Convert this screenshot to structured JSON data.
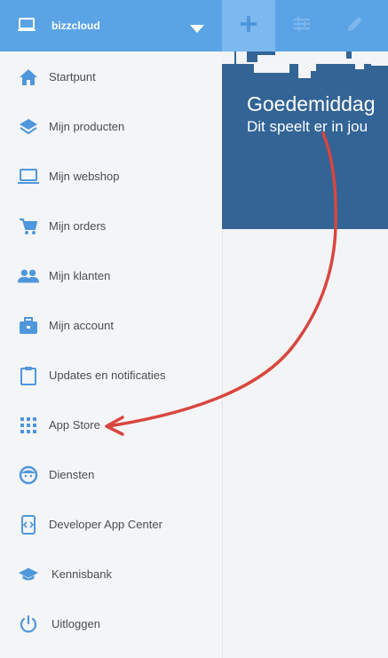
{
  "brand": {
    "name": "bizzcloud"
  },
  "toolbar": {
    "add_icon": "plus-icon",
    "filter_icon": "sliders-icon",
    "edit_icon": "pencil-icon"
  },
  "banner": {
    "greeting": "Goedemiddag",
    "subtitle": "Dit speelt er in jou"
  },
  "menu": [
    {
      "label": "Startpunt",
      "icon": "home-icon"
    },
    {
      "label": "Mijn producten",
      "icon": "layers-icon"
    },
    {
      "label": "Mijn webshop",
      "icon": "laptop-icon"
    },
    {
      "label": "Mijn orders",
      "icon": "cart-icon"
    },
    {
      "label": "Mijn klanten",
      "icon": "people-icon"
    },
    {
      "label": "Mijn account",
      "icon": "briefcase-icon"
    },
    {
      "label": "Updates en notificaties",
      "icon": "clipboard-icon"
    },
    {
      "label": "App Store",
      "icon": "grid-icon"
    },
    {
      "label": "Diensten",
      "icon": "face-icon"
    },
    {
      "label": "Developer App Center",
      "icon": "code-phone-icon"
    },
    {
      "label": "Kennisbank",
      "icon": "graduation-cap-icon"
    },
    {
      "label": "Uitloggen",
      "icon": "power-icon"
    }
  ],
  "colors": {
    "accent": "#5aa4e6",
    "banner": "#336496",
    "icon": "#4f97dc",
    "annotation": "#d9463f"
  }
}
